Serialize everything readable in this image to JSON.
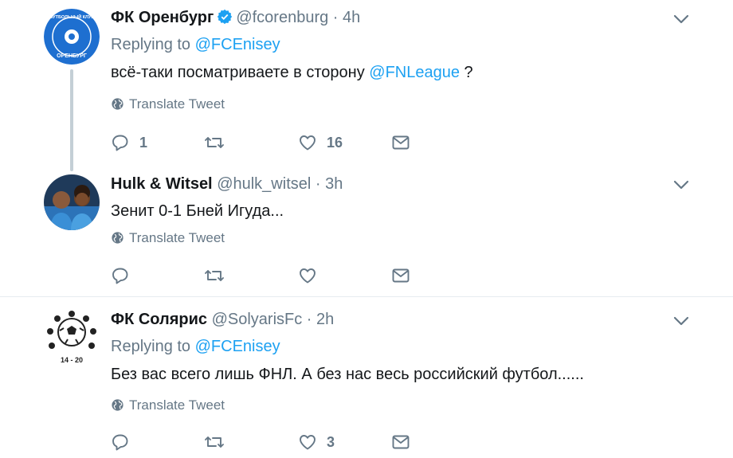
{
  "tweets": [
    {
      "name": "ФК Оренбург",
      "handle": "@fcorenburg",
      "dot": "·",
      "time": "4h",
      "verified": true,
      "avatar_text_top": "ФУТБОЛЬНЫЙ КЛУБ",
      "avatar_text_bottom": "ОРЕНБУРГ",
      "replying_prefix": "Replying to",
      "replying_to": "@FCEnisey",
      "text_before": "всё-таки посматриваете в сторону",
      "text_mention": "@FNLeague",
      "text_after": "?",
      "translate": "Translate Tweet",
      "reply_count": "1",
      "retweet_count": "",
      "like_count": "16"
    },
    {
      "name": "Hulk & Witsel",
      "handle": "@hulk_witsel",
      "dot": "·",
      "time": "3h",
      "text": "Зенит 0-1 Бней Игуда...",
      "translate": "Translate Tweet",
      "reply_count": "",
      "retweet_count": "",
      "like_count": ""
    },
    {
      "name": "ФК Солярис",
      "handle": "@SolyarisFc",
      "dot": "·",
      "time": "2h",
      "avatar_text": "14 - 20",
      "replying_prefix": "Replying to",
      "replying_to": "@FCEnisey",
      "text": "Без вас всего лишь ФНЛ. А без нас весь российский футбол......",
      "translate": "Translate Tweet",
      "reply_count": "",
      "retweet_count": "",
      "like_count": "3"
    }
  ],
  "colors": {
    "link": "#1da1f2",
    "muted": "#657786",
    "text": "#14171a",
    "thread_line": "#c4cfd6",
    "divider": "#e6ecf0"
  },
  "icons": [
    "globe-icon",
    "reply-icon",
    "retweet-icon",
    "like-icon",
    "direct-message-icon",
    "chevron-down-icon",
    "verified-badge-icon"
  ]
}
